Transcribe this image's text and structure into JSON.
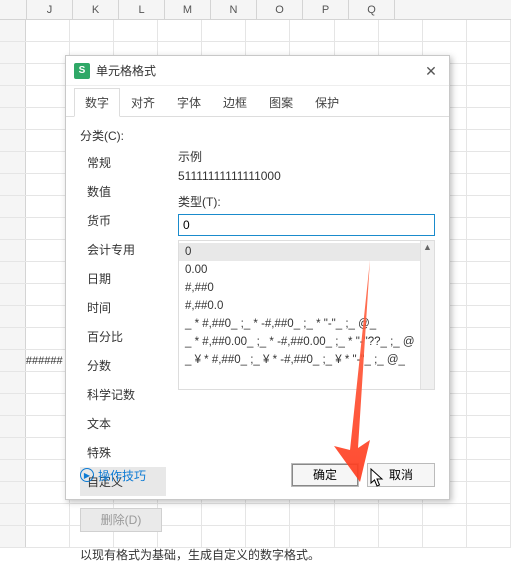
{
  "columns": [
    "J",
    "K",
    "L",
    "M",
    "N",
    "O",
    "P",
    "Q"
  ],
  "overflow_cell": "######",
  "dialog": {
    "logo": "S",
    "title": "单元格格式",
    "close": "✕",
    "tabs": [
      "数字",
      "对齐",
      "字体",
      "边框",
      "图案",
      "保护"
    ],
    "active_tab": 0,
    "category_label": "分类(C):",
    "categories": [
      "常规",
      "数值",
      "货币",
      "会计专用",
      "日期",
      "时间",
      "百分比",
      "分数",
      "科学记数",
      "文本",
      "特殊",
      "自定义"
    ],
    "selected_category": 11,
    "delete_label": "删除(D)",
    "example_label": "示例",
    "example_value": "51111111111111000",
    "type_label": "类型(T):",
    "type_value": "0",
    "format_options": [
      "0",
      "0.00",
      "#,##0",
      "#,##0.0",
      "_ * #,##0_ ;_ * -#,##0_ ;_ * \"-\"_ ;_ @_",
      "_ * #,##0.00_ ;_ * -#,##0.00_ ;_ * \"-\"??_ ;_ @",
      "_ ¥ * #,##0_ ;_ ¥ * -#,##0_ ;_ ¥ * \"-\"_ ;_ @_"
    ],
    "selected_format": 0,
    "note": "以现有格式为基础，生成自定义的数字格式。",
    "tips_label": "操作技巧",
    "ok_label": "确定",
    "cancel_label": "取消"
  }
}
